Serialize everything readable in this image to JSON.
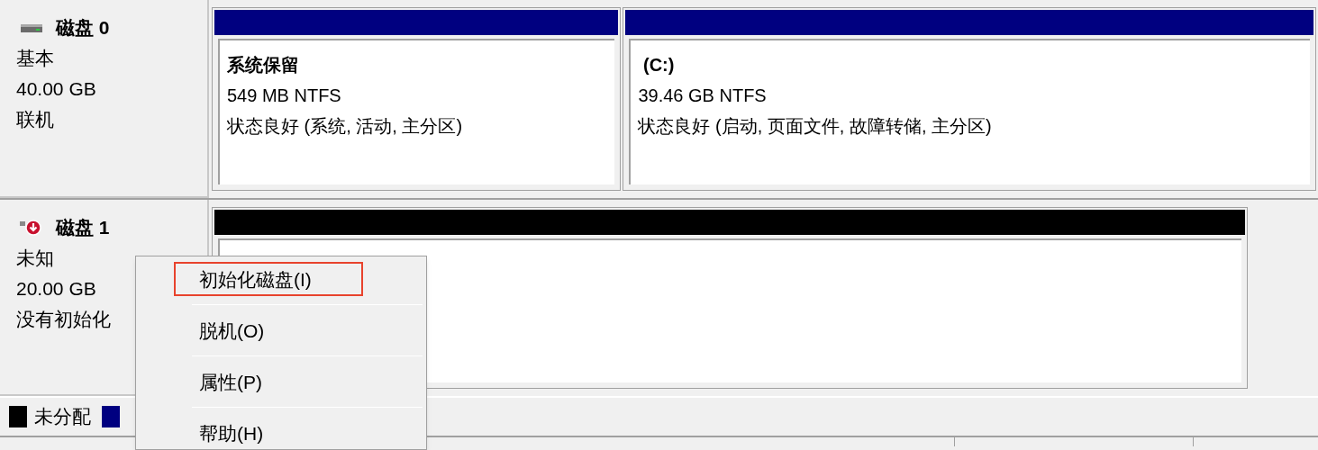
{
  "disks": [
    {
      "name": "磁盘 0",
      "kind": "online",
      "lines": [
        "基本",
        "40.00 GB",
        "联机"
      ],
      "partitions": [
        {
          "color": "#000080",
          "name": "系统保留",
          "lines": [
            "549 MB NTFS",
            "状态良好 (系统, 活动, 主分区)"
          ]
        },
        {
          "color": "#000080",
          "name": " (C:)",
          "lines": [
            "39.46 GB NTFS",
            "状态良好 (启动, 页面文件, 故障转储, 主分区)"
          ]
        }
      ]
    },
    {
      "name": "磁盘 1",
      "kind": "error",
      "lines": [
        "未知",
        "20.00 GB",
        "没有初始化"
      ],
      "partitions": [
        {
          "color": "#000000"
        }
      ]
    }
  ],
  "legend": [
    {
      "color": "#000000",
      "label": "未分配"
    },
    {
      "color": "#000080"
    }
  ],
  "context_menu": [
    {
      "label": "初始化磁盘(I)",
      "highlighted": true
    },
    {
      "label": "脱机(O)",
      "highlighted": false
    },
    {
      "label": "属性(P)",
      "highlighted": false
    },
    {
      "label": "帮助(H)",
      "highlighted": false
    }
  ]
}
